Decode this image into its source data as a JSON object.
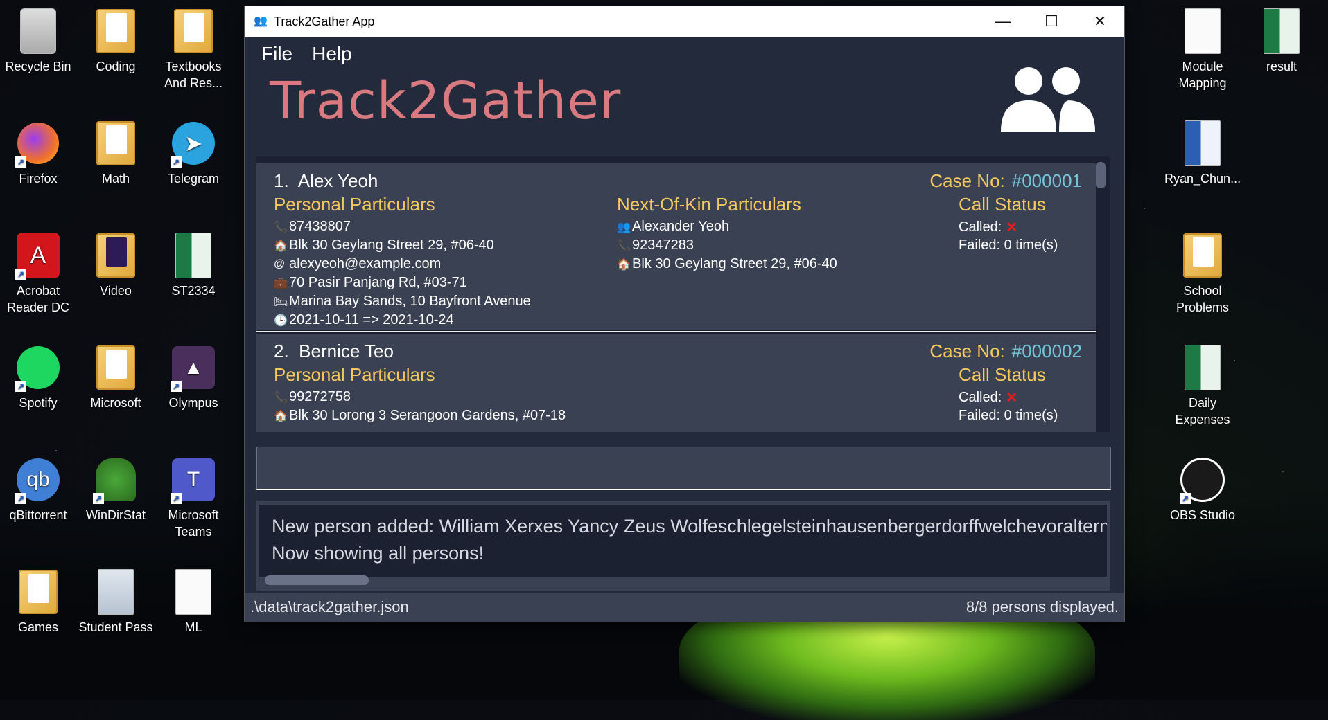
{
  "desktop": {
    "icons": [
      {
        "label": "Recycle Bin",
        "icon": "recycle-bin-icon"
      },
      {
        "label": "Coding",
        "icon": "folder-icon"
      },
      {
        "label": "Textbooks And Res...",
        "icon": "folder-icon"
      },
      {
        "label": "Firefox",
        "icon": "firefox-icon"
      },
      {
        "label": "Math",
        "icon": "folder-icon"
      },
      {
        "label": "Telegram",
        "icon": "telegram-icon"
      },
      {
        "label": "Acrobat Reader DC",
        "icon": "acrobat-icon"
      },
      {
        "label": "Video",
        "icon": "folder-icon"
      },
      {
        "label": "ST2334",
        "icon": "excel-icon"
      },
      {
        "label": "Spotify",
        "icon": "spotify-icon"
      },
      {
        "label": "Microsoft",
        "icon": "folder-icon"
      },
      {
        "label": "Olympus",
        "icon": "olympus-icon"
      },
      {
        "label": "qBittorrent",
        "icon": "qbittorrent-icon"
      },
      {
        "label": "WinDirStat",
        "icon": "windirstat-icon"
      },
      {
        "label": "Microsoft Teams",
        "icon": "teams-icon"
      },
      {
        "label": "Games",
        "icon": "folder-icon"
      },
      {
        "label": "Student Pass",
        "icon": "image-icon"
      },
      {
        "label": "ML",
        "icon": "document-icon"
      },
      {
        "label": "Module Mapping",
        "icon": "document-icon"
      },
      {
        "label": "result",
        "icon": "excel-icon"
      },
      {
        "label": "Ryan_Chun...",
        "icon": "word-icon"
      },
      {
        "label": "School Problems",
        "icon": "folder-icon"
      },
      {
        "label": "Daily Expenses",
        "icon": "excel-icon"
      },
      {
        "label": "OBS Studio",
        "icon": "obs-icon"
      }
    ]
  },
  "window": {
    "title": "Track2Gather App",
    "minimize": "—",
    "maximize": "☐",
    "close": "✕"
  },
  "menu": {
    "file": "File",
    "help": "Help"
  },
  "header": {
    "brand": "Track2Gather"
  },
  "persons": [
    {
      "index": "1.",
      "name": "Alex Yeoh",
      "case_label": "Case No:",
      "case_no": "#000001",
      "personal_title": "Personal Particulars",
      "phone": "87438807",
      "address": "Blk 30 Geylang Street 29, #06-40",
      "email": "alexyeoh@example.com",
      "work": "70 Pasir Panjang Rd, #03-71",
      "quarantine": "Marina Bay Sands, 10 Bayfront Avenue",
      "period": "2021-10-11 => 2021-10-24",
      "nok_title": "Next-Of-Kin Particulars",
      "nok_name": "Alexander Yeoh",
      "nok_phone": "92347283",
      "nok_address": "Blk 30 Geylang Street 29, #06-40",
      "call_title": "Call Status",
      "called": "Called:",
      "failed": "Failed: 0 time(s)"
    },
    {
      "index": "2.",
      "name": "Bernice Teo",
      "case_label": "Case No:",
      "case_no": "#000002",
      "personal_title": "Personal Particulars",
      "phone": "99272758",
      "address": "Blk 30 Lorong 3 Serangoon Gardens, #07-18",
      "call_title": "Call Status",
      "called": "Called:",
      "failed": "Failed: 0 time(s)"
    }
  ],
  "command": {
    "value": ""
  },
  "result": {
    "line1": "New person added: William Xerxes Yancy Zeus Wolfeschlegelsteinhausenbergerdorffwelchevoralternwar",
    "line2": "Now showing all persons!"
  },
  "status": {
    "path": ".\\data\\track2gather.json",
    "count": "8/8 persons displayed."
  }
}
